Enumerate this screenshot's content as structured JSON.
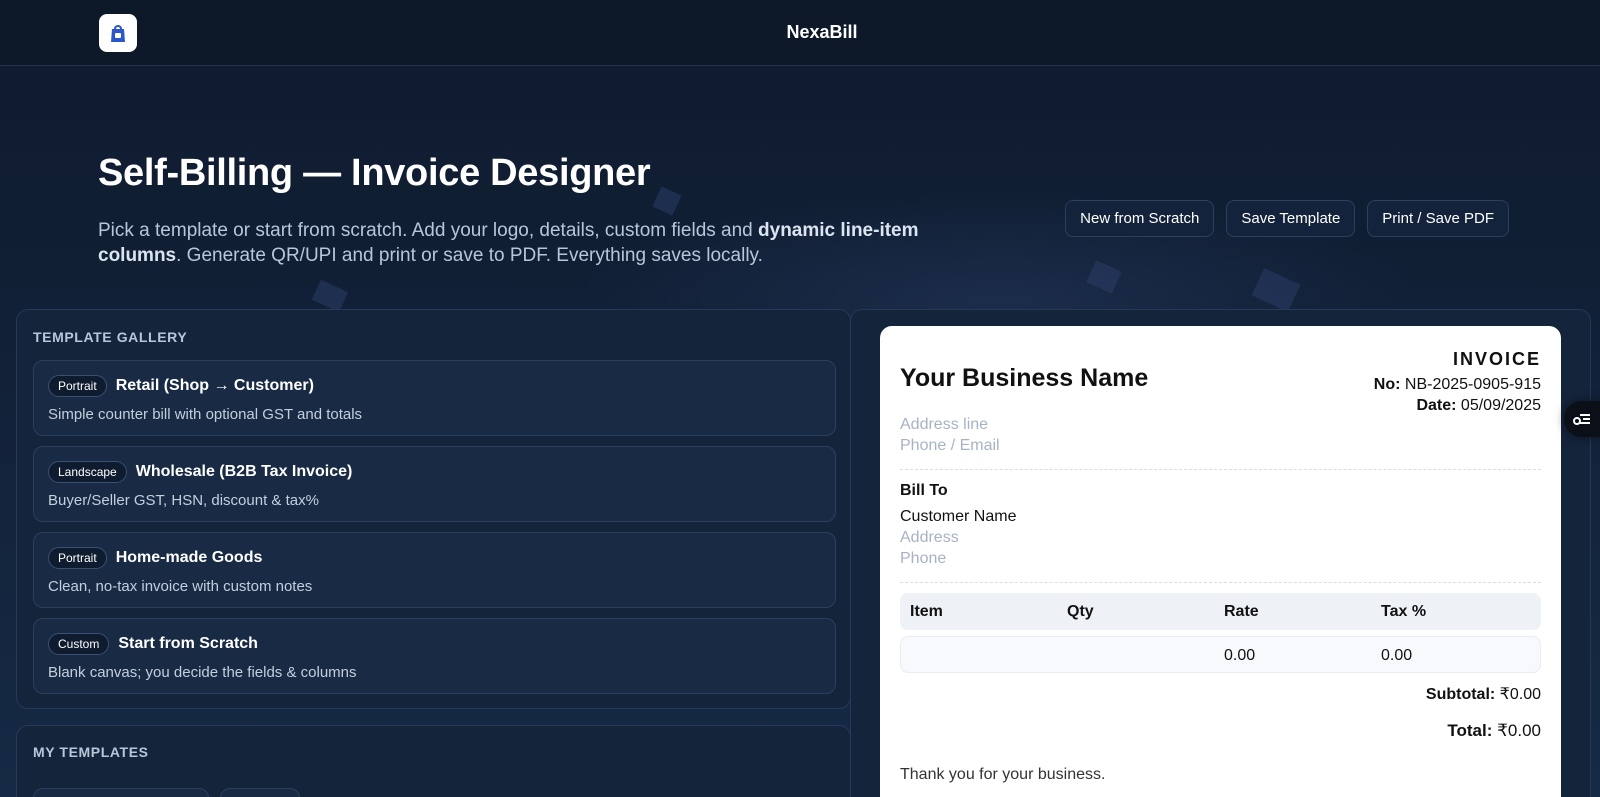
{
  "header": {
    "brand": "NexaBill"
  },
  "hero": {
    "title": "Self-Billing — Invoice Designer",
    "subtitle_part1": "Pick a template or start from scratch. Add your logo, details, custom fields and ",
    "subtitle_bold": "dynamic line-item columns",
    "subtitle_part2": ". Generate QR/UPI and print or save to PDF. Everything saves locally."
  },
  "actions": {
    "new_label": "New from Scratch",
    "save_label": "Save Template",
    "print_label": "Print / Save PDF"
  },
  "gallery": {
    "title": "TEMPLATE GALLERY",
    "templates": [
      {
        "orientation": "Portrait",
        "name": "Retail (Shop → Customer)",
        "desc": "Simple counter bill with optional GST and totals"
      },
      {
        "orientation": "Landscape",
        "name": "Wholesale (B2B Tax Invoice)",
        "desc": "Buyer/Seller GST, HSN, discount & tax%"
      },
      {
        "orientation": "Portrait",
        "name": "Home-made Goods",
        "desc": "Clean, no-tax invoice with custom notes"
      },
      {
        "orientation": "Custom",
        "name": "Start from Scratch",
        "desc": "Blank canvas; you decide the fields & columns"
      }
    ]
  },
  "my_templates": {
    "title": "MY TEMPLATES"
  },
  "invoice": {
    "business_name": "Your Business Name",
    "address_placeholder": "Address line",
    "contact_placeholder": "Phone / Email",
    "label": "INVOICE",
    "no_label": "No:",
    "no_value": "NB-2025-0905-915",
    "date_label": "Date:",
    "date_value": "05/09/2025",
    "bill_to_label": "Bill To",
    "customer_name": "Customer Name",
    "customer_address_placeholder": "Address",
    "customer_phone_placeholder": "Phone",
    "columns": [
      "Item",
      "Qty",
      "Rate",
      "Tax %"
    ],
    "rows": [
      [
        "",
        "",
        "0.00",
        "0.00"
      ]
    ],
    "subtotal_label": "Subtotal:",
    "subtotal_value": "₹0.00",
    "total_label": "Total:",
    "total_value": "₹0.00",
    "footer_note": "Thank you for your business."
  },
  "icons": {
    "logo": "shopping-bag-icon",
    "floating": "settings-sliders-icon"
  }
}
